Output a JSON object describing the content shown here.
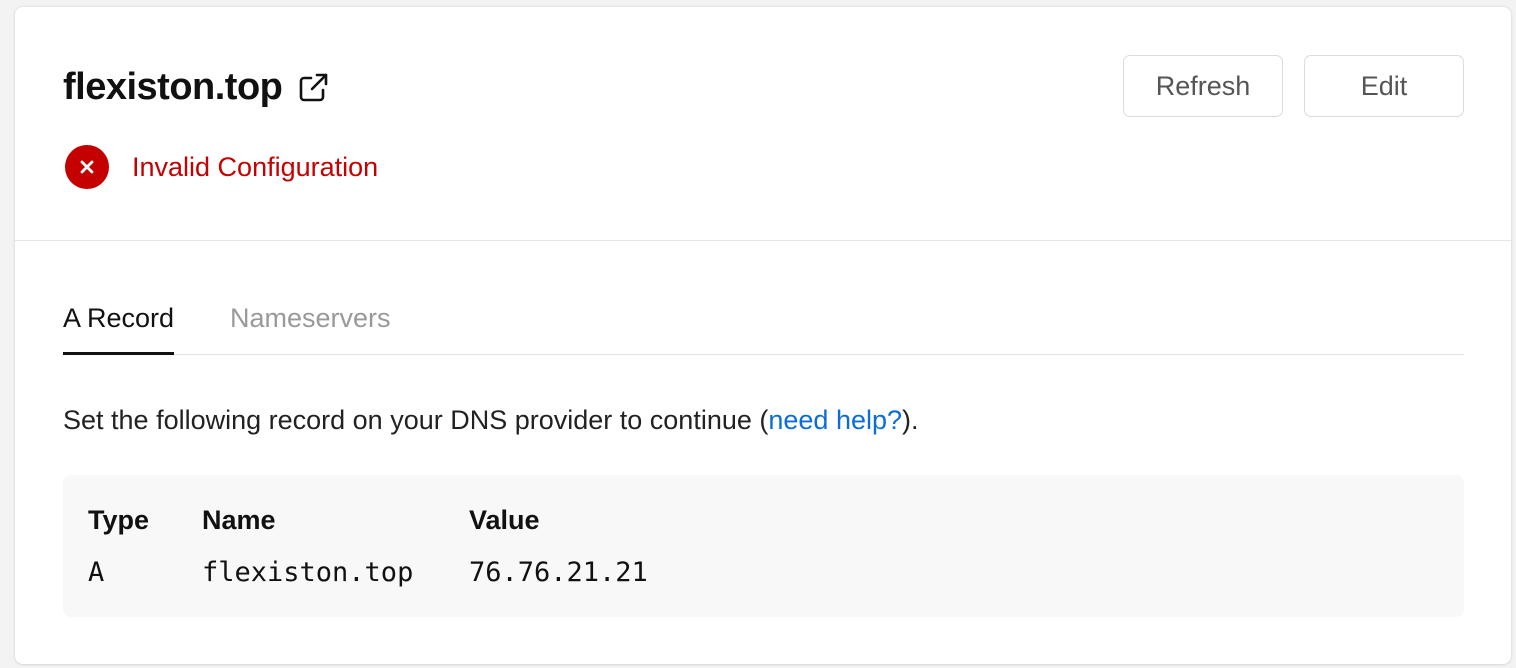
{
  "domain": {
    "title": "flexiston.top",
    "status": "Invalid Configuration",
    "status_color": "#c50000"
  },
  "buttons": {
    "refresh": "Refresh",
    "edit": "Edit"
  },
  "tabs": [
    {
      "label": "A Record",
      "active": true
    },
    {
      "label": "Nameservers",
      "active": false
    }
  ],
  "instructions": {
    "prefix": "Set the following record on your DNS provider to continue (",
    "link": "need help?",
    "suffix": ")."
  },
  "record": {
    "headers": [
      "Type",
      "Name",
      "Value"
    ],
    "row": [
      "A",
      "flexiston.top",
      "76.76.21.21"
    ]
  },
  "icons": {
    "external_link": "external-link-icon",
    "error": "error-x-icon"
  }
}
